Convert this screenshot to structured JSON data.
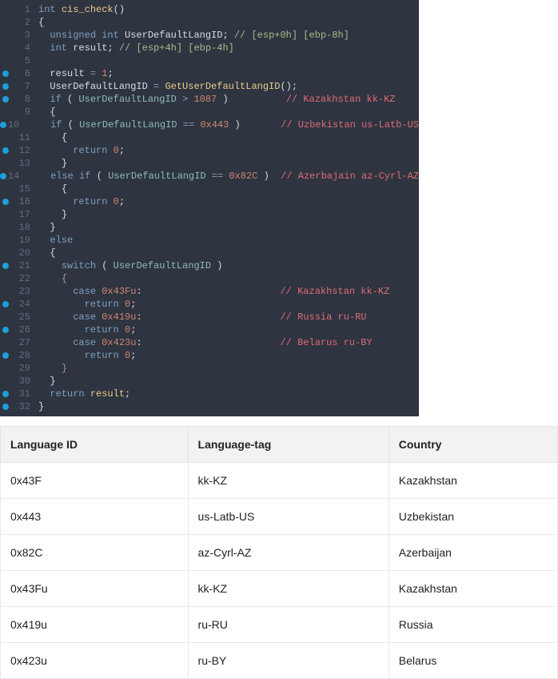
{
  "code": {
    "lines": [
      {
        "n": 1,
        "bp": false,
        "html": "<span class='kw'>int</span> <span class='fn'>cis_check</span><span class='txt'>()</span>"
      },
      {
        "n": 2,
        "bp": false,
        "html": "<span class='txt'>{</span>"
      },
      {
        "n": 3,
        "bp": false,
        "html": "  <span class='kw'>unsigned</span> <span class='kw'>int</span> <span class='txt'>UserDefaultLangID;</span> <span class='cm'>// [esp+0h] [ebp-8h]</span>"
      },
      {
        "n": 4,
        "bp": false,
        "html": "  <span class='kw'>int</span> <span class='txt'>result;</span> <span class='cm'>// [esp+4h] [ebp-4h]</span>"
      },
      {
        "n": 5,
        "bp": false,
        "html": ""
      },
      {
        "n": 6,
        "bp": true,
        "html": "  <span class='txt'>result</span> <span class='op'>=</span> <span class='num'>1</span><span class='txt'>;</span>"
      },
      {
        "n": 7,
        "bp": true,
        "html": "  <span class='txt'>UserDefaultLangID</span> <span class='op'>=</span> <span class='fn'>GetUserDefaultLangID</span><span class='txt'>();</span>"
      },
      {
        "n": 8,
        "bp": true,
        "html": "  <span class='kw'>if</span> <span class='txt'>(</span> <span class='id'>UserDefaultLangID</span> <span class='op'>&gt;</span> <span class='num'>1087</span> <span class='txt'>)</span>          <span class='cmr'>// Kazakhstan kk-KZ</span>"
      },
      {
        "n": 9,
        "bp": false,
        "html": "  <span class='txt'>{</span>"
      },
      {
        "n": 10,
        "bp": true,
        "html": "    <span class='kw'>if</span> <span class='txt'>(</span> <span class='id'>UserDefaultLangID</span> <span class='op'>==</span> <span class='num'>0x443</span> <span class='txt'>)</span>       <span class='cmr'>// Uzbekistan us-Latb-US</span>"
      },
      {
        "n": 11,
        "bp": false,
        "html": "    <span class='txt'>{</span>"
      },
      {
        "n": 12,
        "bp": true,
        "html": "      <span class='kw'>return</span> <span class='num'>0</span><span class='txt'>;</span>"
      },
      {
        "n": 13,
        "bp": false,
        "html": "    <span class='txt'>}</span>"
      },
      {
        "n": 14,
        "bp": true,
        "html": "    <span class='kw'>else</span> <span class='kw'>if</span> <span class='txt'>(</span> <span class='id'>UserDefaultLangID</span> <span class='op'>==</span> <span class='num'>0x82C</span> <span class='txt'>)</span>  <span class='cmr'>// Azerbajain az-Cyrl-AZ</span>"
      },
      {
        "n": 15,
        "bp": false,
        "html": "    <span class='txt'>{</span>"
      },
      {
        "n": 16,
        "bp": true,
        "html": "      <span class='kw'>return</span> <span class='num'>0</span><span class='txt'>;</span>"
      },
      {
        "n": 17,
        "bp": false,
        "html": "    <span class='txt'>}</span>"
      },
      {
        "n": 18,
        "bp": false,
        "html": "  <span class='txt'>}</span>"
      },
      {
        "n": 19,
        "bp": false,
        "html": "  <span class='kw'>else</span>"
      },
      {
        "n": 20,
        "bp": false,
        "html": "  <span class='txt'>{</span>"
      },
      {
        "n": 21,
        "bp": true,
        "html": "    <span class='kw'>switch</span> <span class='txt'>(</span> <span class='id'>UserDefaultLangID</span> <span class='txt'>)</span>"
      },
      {
        "n": 22,
        "bp": false,
        "html": "    <span class='paren'>{</span>"
      },
      {
        "n": 23,
        "bp": false,
        "html": "      <span class='kw'>case</span> <span class='num'>0x43Fu</span><span class='txt'>:</span>                        <span class='cmr'>// Kazakhstan kk-KZ</span>"
      },
      {
        "n": 24,
        "bp": true,
        "html": "        <span class='kw'>return</span> <span class='num'>0</span><span class='txt'>;</span>"
      },
      {
        "n": 25,
        "bp": false,
        "html": "      <span class='kw'>case</span> <span class='num'>0x419u</span><span class='txt'>:</span>                        <span class='cmr'>// Russia ru-RU</span>"
      },
      {
        "n": 26,
        "bp": true,
        "html": "        <span class='kw'>return</span> <span class='num'>0</span><span class='txt'>;</span>"
      },
      {
        "n": 27,
        "bp": false,
        "html": "      <span class='kw'>case</span> <span class='num'>0x423u</span><span class='txt'>:</span>                        <span class='cmr'>// Belarus ru-BY</span>"
      },
      {
        "n": 28,
        "bp": true,
        "html": "        <span class='kw'>return</span> <span class='num'>0</span><span class='txt'>;</span>"
      },
      {
        "n": 29,
        "bp": false,
        "html": "    <span class='paren'>}</span>"
      },
      {
        "n": 30,
        "bp": false,
        "html": "  <span class='txt'>}</span>"
      },
      {
        "n": 31,
        "bp": true,
        "html": "  <span class='kw'>return</span> <span class='fn'>result</span><span class='txt'>;</span>"
      },
      {
        "n": 32,
        "bp": true,
        "html": "<span class='txt'>}</span>"
      }
    ]
  },
  "table": {
    "headers": [
      "Language ID",
      "Language-tag",
      "Country"
    ],
    "rows": [
      [
        "0x43F",
        "kk-KZ",
        "Kazakhstan"
      ],
      [
        "0x443",
        "us-Latb-US",
        "Uzbekistan"
      ],
      [
        "0x82C",
        "az-Cyrl-AZ",
        "Azerbaijan"
      ],
      [
        "0x43Fu",
        "kk-KZ",
        "Kazakhstan"
      ],
      [
        "0x419u",
        "ru-RU",
        "Russia"
      ],
      [
        "0x423u",
        "ru-BY",
        "Belarus"
      ]
    ]
  }
}
